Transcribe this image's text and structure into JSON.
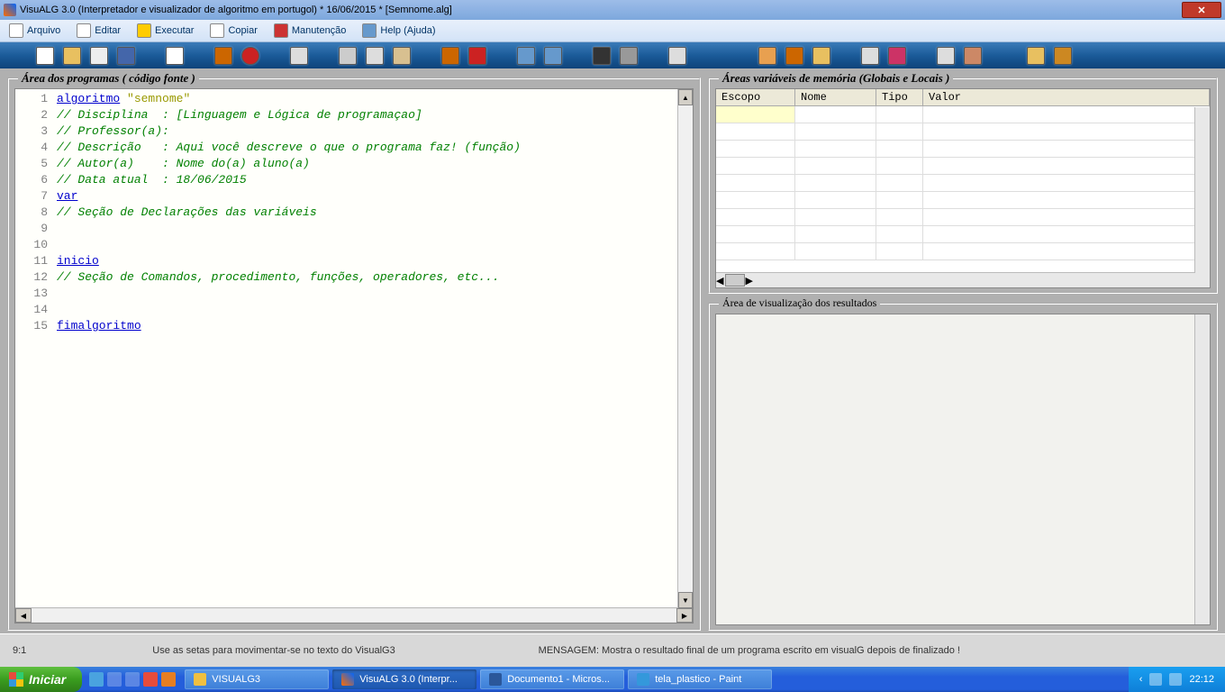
{
  "window": {
    "title": "VisuALG 3.0  (Interpretador e visualizador de algoritmo em portugol) * 16/06/2015 * [Semnome.alg]"
  },
  "menu": {
    "arquivo": "Arquivo",
    "editar": "Editar",
    "executar": "Executar",
    "copiar": "Copiar",
    "manutencao": "Manutenção",
    "help": "Help (Ajuda)"
  },
  "panels": {
    "code_legend": "Área dos programas ( código fonte )",
    "vars_legend": "Áreas variáveis de memória (Globais e Locais )",
    "results_legend": "Área de visualização dos resultados"
  },
  "vars_headers": {
    "escopo": "Escopo",
    "nome": "Nome",
    "tipo": "Tipo",
    "valor": "Valor"
  },
  "code": {
    "lines": [
      "1",
      "2",
      "3",
      "4",
      "5",
      "6",
      "7",
      "8",
      "9",
      "10",
      "11",
      "12",
      "13",
      "14",
      "15"
    ],
    "l1_kw": "algoritmo",
    "l1_str": "\"semnome\"",
    "l2": "// Disciplina  : [Linguagem e Lógica de programaçao]",
    "l3": "// Professor(a):",
    "l4": "// Descrição   : Aqui você descreve o que o programa faz! (função)",
    "l5": "// Autor(a)    : Nome do(a) aluno(a)",
    "l6": "// Data atual  : 18/06/2015",
    "l7_kw": "var",
    "l8": "// Seção de Declarações das variáveis",
    "l11_kw": "inicio",
    "l12": "// Seção de Comandos, procedimento, funções, operadores, etc...",
    "l15_kw": "fimalgoritmo"
  },
  "status": {
    "cursor": "9:1",
    "hint": "Use as setas para movimentar-se no texto do VisualG3",
    "message": "MENSAGEM: Mostra o resultado final de um programa escrito em visualG depois de finalizado !"
  },
  "taskbar": {
    "start": "Iniciar",
    "task1": "VISUALG3",
    "task2": "VisuALG 3.0  (Interpr...",
    "task3": "Documento1 - Micros...",
    "task4": "tela_plastico - Paint",
    "clock": "22:12"
  }
}
